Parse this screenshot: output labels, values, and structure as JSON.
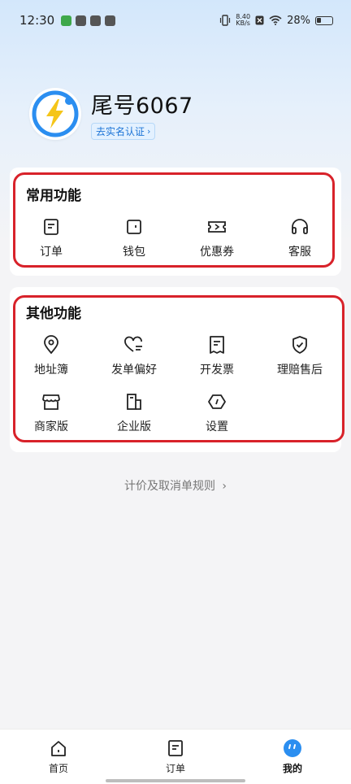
{
  "status_bar": {
    "time": "12:30",
    "net_speed_value": "8.40",
    "net_speed_unit": "KB/s",
    "battery": "28%"
  },
  "profile": {
    "name": "尾号6067",
    "verify_label": "去实名认证"
  },
  "common_functions": {
    "title": "常用功能",
    "items": [
      {
        "label": "订单",
        "icon": "order-icon"
      },
      {
        "label": "钱包",
        "icon": "wallet-icon"
      },
      {
        "label": "优惠券",
        "icon": "coupon-icon"
      },
      {
        "label": "客服",
        "icon": "headset-icon"
      }
    ]
  },
  "other_functions": {
    "title": "其他功能",
    "items": [
      {
        "label": "地址簿",
        "icon": "location-pin-icon"
      },
      {
        "label": "发单偏好",
        "icon": "heart-preference-icon"
      },
      {
        "label": "开发票",
        "icon": "invoice-icon"
      },
      {
        "label": "理赔售后",
        "icon": "shield-check-icon"
      },
      {
        "label": "商家版",
        "icon": "store-icon"
      },
      {
        "label": "企业版",
        "icon": "building-icon"
      },
      {
        "label": "设置",
        "icon": "settings-icon"
      }
    ]
  },
  "rules_link": "计价及取消单规则",
  "tabbar": {
    "items": [
      {
        "label": "首页",
        "icon": "home-icon"
      },
      {
        "label": "订单",
        "icon": "order-icon"
      },
      {
        "label": "我的",
        "icon": "profile-icon",
        "active": true
      }
    ]
  },
  "colors": {
    "accent": "#2b8ef0",
    "logo_yellow": "#f5c518",
    "highlight": "#d8222a"
  }
}
